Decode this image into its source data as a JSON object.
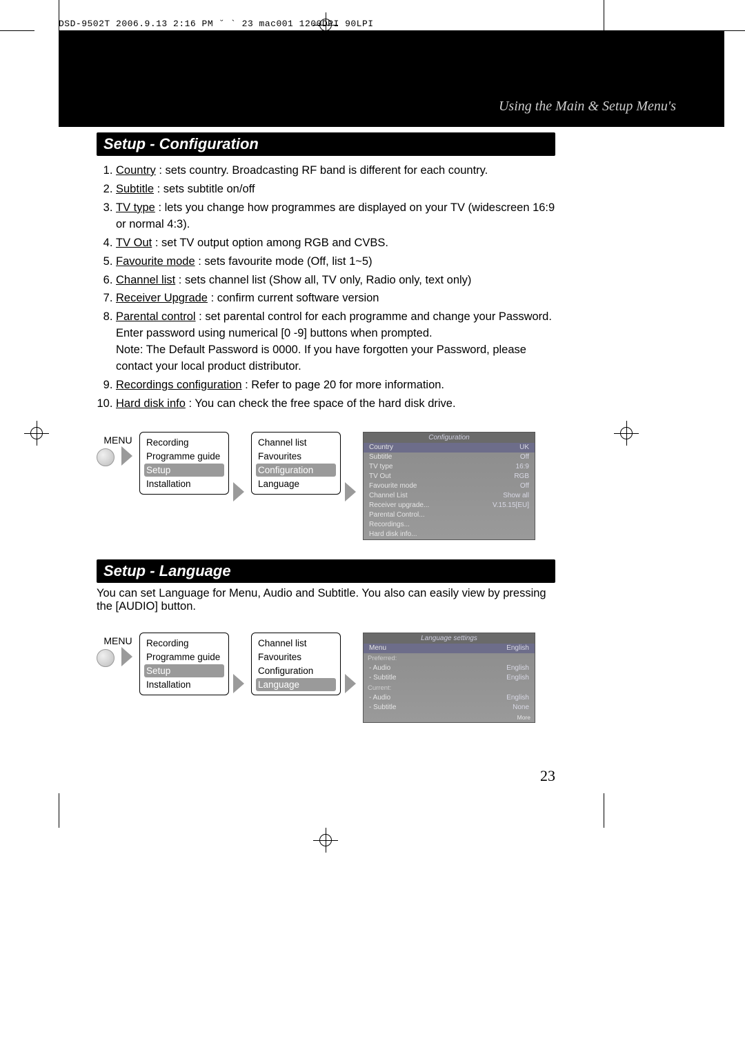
{
  "header_strip": "DSD-9502T  2006.9.13 2:16 PM  ˘ ` 23   mac001  1200DPI 90LPI",
  "breadcrumb": "Using the Main & Setup Menu's",
  "page_number": "23",
  "section1": {
    "title": "Setup - Configuration",
    "items": [
      {
        "term": "Country",
        "desc": " : sets country.  Broadcasting RF band is different for each country."
      },
      {
        "term": "Subtitle",
        "desc": " : sets subtitle on/off"
      },
      {
        "term": "TV type",
        "desc": " : lets you change how programmes are displayed on your TV (widescreen 16:9 or normal 4:3)."
      },
      {
        "term": "TV Out",
        "desc": " : set TV output option among RGB and CVBS."
      },
      {
        "term": "Favourite mode",
        "desc": " : sets favourite mode (Off, list 1~5)"
      },
      {
        "term": "Channel list",
        "desc": " : sets channel list (Show all, TV only, Radio only, text only)"
      },
      {
        "term": "Receiver Upgrade",
        "desc": " : confirm current software version"
      },
      {
        "term": "Parental control",
        "desc": " : set parental control for each programme and change your Password. Enter password using numerical [0 -9] buttons when prompted.",
        "note": "Note: The Default Password is 0000. If you have forgotten your Password, please contact your local product distributor."
      },
      {
        "term": "Recordings configuration",
        "desc": " : Refer to page 20 for more information."
      },
      {
        "term": "Hard disk info",
        "desc": " : You can check the free space of the hard disk drive."
      }
    ]
  },
  "section2": {
    "title": "Setup - Language",
    "intro": "You can set Language for Menu, Audio and Subtitle. You also can easily view by pressing the [AUDIO] button."
  },
  "menu_label": "MENU",
  "menu_box1": {
    "items": [
      "Recording",
      "Programme guide",
      "Setup",
      "Installation"
    ],
    "selected": 2
  },
  "menu_box2_config": {
    "items": [
      "Channel list",
      "Favourites",
      "Configuration",
      "Language"
    ],
    "selected": 2
  },
  "menu_box2_lang": {
    "items": [
      "Channel list",
      "Favourites",
      "Configuration",
      "Language"
    ],
    "selected": 3
  },
  "osd_config": {
    "title": "Configuration",
    "rows": [
      {
        "label": "Country",
        "value": "UK",
        "sel": true
      },
      {
        "label": "Subtitle",
        "value": "Off"
      },
      {
        "label": "TV type",
        "value": "16:9"
      },
      {
        "label": "TV Out",
        "value": "RGB"
      },
      {
        "label": "Favourite mode",
        "value": "Off"
      },
      {
        "label": "Channel List",
        "value": "Show all"
      },
      {
        "label": "Receiver upgrade...",
        "value": "V.15.15[EU]"
      },
      {
        "label": "Parental Control...",
        "value": ""
      },
      {
        "label": "Recordings...",
        "value": ""
      },
      {
        "label": "Hard disk info...",
        "value": ""
      }
    ]
  },
  "osd_lang": {
    "title": "Language settings",
    "menu_row": {
      "label": "Menu",
      "value": "English"
    },
    "preferred_label": "Preferred:",
    "preferred": [
      {
        "label": "- Audio",
        "value": "English"
      },
      {
        "label": "- Subtitle",
        "value": "English"
      }
    ],
    "current_label": "Current:",
    "current": [
      {
        "label": "- Audio",
        "value": "English"
      },
      {
        "label": "- Subtitle",
        "value": "None"
      }
    ],
    "footer": "More"
  }
}
